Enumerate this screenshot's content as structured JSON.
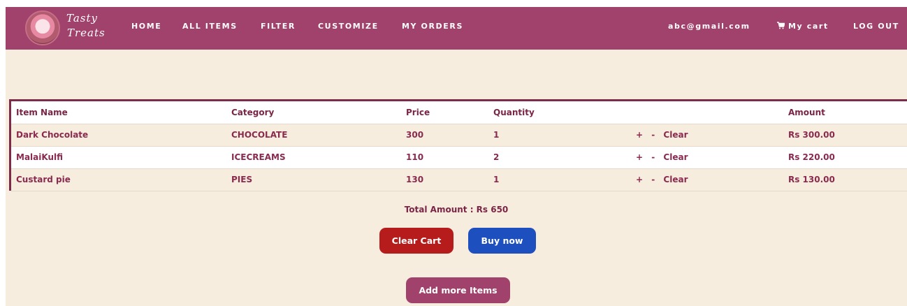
{
  "brand": {
    "line1": "Tasty",
    "line2": "Treats"
  },
  "nav": {
    "home": "HOME",
    "all_items": "ALL ITEMS",
    "filter": "FILTER",
    "customize": "CUSTOMIZE",
    "my_orders": "MY ORDERS",
    "email": "abc@gmail.com",
    "cart": "My cart",
    "logout": "LOG OUT"
  },
  "table": {
    "headers": [
      "Item Name",
      "Category",
      "Price",
      "Quantity",
      "",
      "Amount"
    ],
    "rows": [
      {
        "name": "Dark Chocolate",
        "category": "CHOCOLATE",
        "price": "300",
        "quantity": "1",
        "plus": "+",
        "minus": "-",
        "clear": "Clear",
        "amount": "Rs 300.00"
      },
      {
        "name": "MalaiKulfi",
        "category": "ICECREAMS",
        "price": "110",
        "quantity": "2",
        "plus": "+",
        "minus": "-",
        "clear": "Clear",
        "amount": "Rs 220.00"
      },
      {
        "name": "Custard pie",
        "category": "PIES",
        "price": "130",
        "quantity": "1",
        "plus": "+",
        "minus": "-",
        "clear": "Clear",
        "amount": "Rs 130.00"
      }
    ]
  },
  "total": "Total Amount : Rs 650",
  "buttons": {
    "clear_cart": "Clear Cart",
    "buy_now": "Buy now",
    "add_more": "Add more Items"
  },
  "colors": {
    "navbar": "#a0426c",
    "background": "#f6eddf",
    "text_accent": "#8a2a4e",
    "clear_button": "#b71c1c",
    "buy_button": "#1d4fbf",
    "add_button": "#a0426c"
  }
}
